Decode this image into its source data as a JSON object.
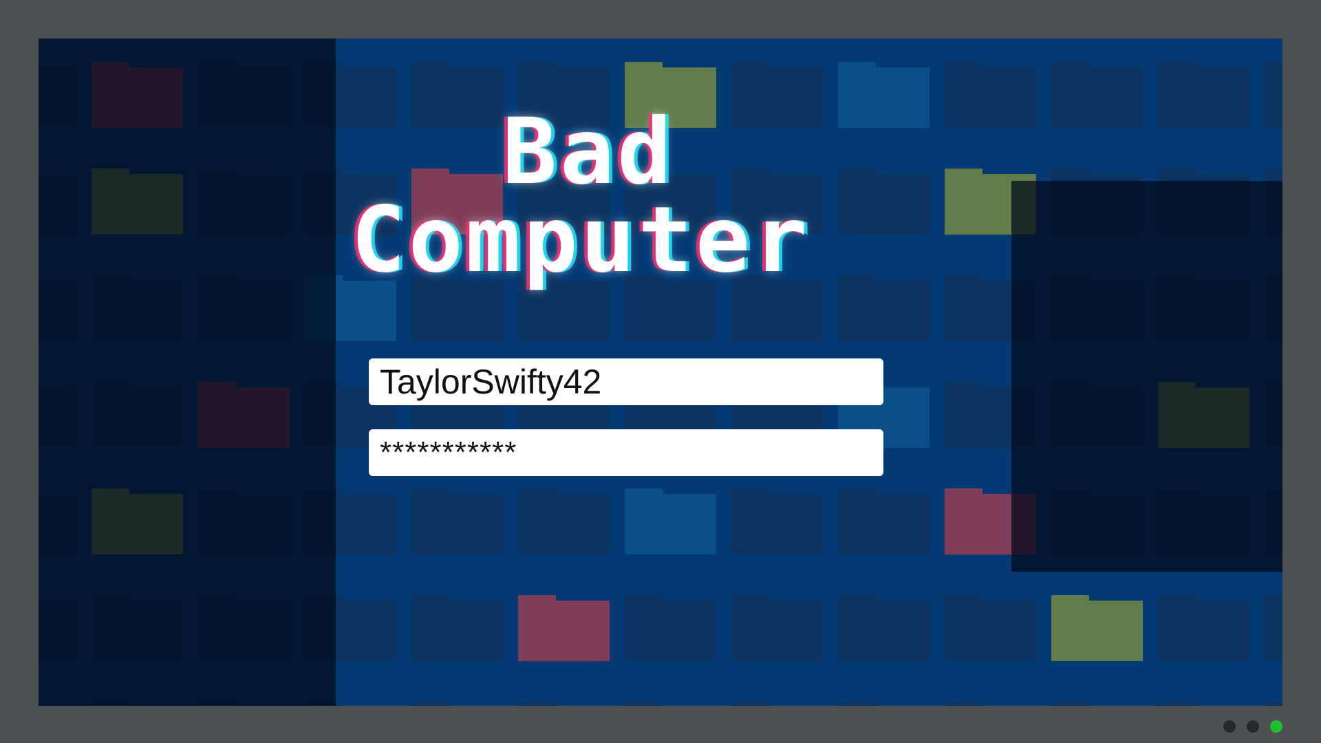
{
  "title": {
    "line1": "Bad",
    "line2": "Computer"
  },
  "login": {
    "username_value": "TaylorSwifty42",
    "password_value": "***********"
  },
  "slide_dots": {
    "count": 3,
    "active_index": 2,
    "inactive_color": "#25292b",
    "active_color": "#1fbf2e"
  },
  "colors": {
    "screen_bg": "#033a73",
    "frame": "#4d5154",
    "folder_green": "#617c4a",
    "folder_red": "#7f3d5a",
    "folder_blue": "#0a4f8a",
    "folder_dark": "#0d3360"
  }
}
